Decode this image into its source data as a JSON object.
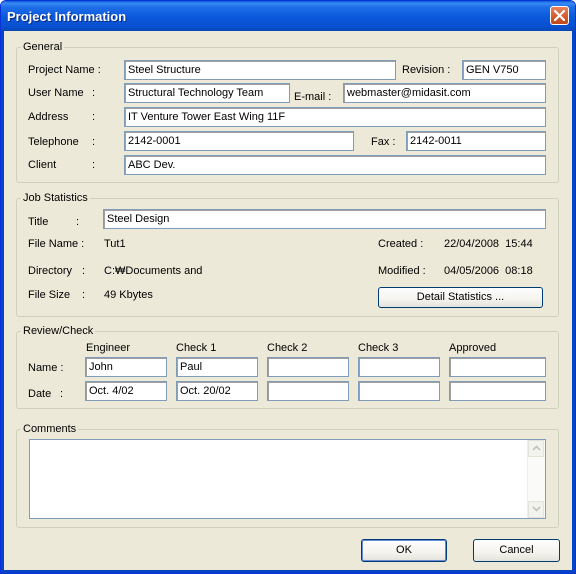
{
  "window": {
    "title": "Project Information"
  },
  "general": {
    "legend": "General",
    "project_name_label": "Project Name :",
    "project_name": "Steel Structure",
    "revision_label": "Revision :",
    "revision": "GEN V750",
    "user_name_label": "User Name",
    "user_name": "Structural Technology Team",
    "email_label": "E-mail :",
    "email": "webmaster@midasit.com",
    "address_label": "Address",
    "address": "IT Venture Tower East Wing 11F",
    "telephone_label": "Telephone",
    "telephone": "2142-0001",
    "fax_label": "Fax :",
    "fax": "2142-0011",
    "client_label": "Client",
    "client": "ABC Dev.",
    "colon": ":"
  },
  "job": {
    "legend": "Job Statistics",
    "title_label": "Title",
    "title": "Steel Design",
    "file_name_label": "File Name :",
    "file_name": "Tut1",
    "directory_label": "Directory",
    "directory": "C:₩Documents and",
    "file_size_label": "File Size",
    "file_size": "49 Kbytes",
    "created_label": "Created :",
    "created": "22/04/2008  15:44",
    "modified_label": "Modified :",
    "modified": "04/05/2006  08:18",
    "detail_button": "Detail Statistics ..."
  },
  "review": {
    "legend": "Review/Check",
    "columns": [
      "Engineer",
      "Check 1",
      "Check 2",
      "Check 3",
      "Approved"
    ],
    "name_label": "Name :",
    "date_label": "Date",
    "names": [
      "John",
      "Paul",
      "",
      "",
      ""
    ],
    "dates": [
      "Oct. 4/02",
      "Oct. 20/02",
      "",
      "",
      ""
    ]
  },
  "comments": {
    "legend": "Comments",
    "text": ""
  },
  "buttons": {
    "ok": "OK",
    "cancel": "Cancel"
  },
  "icons": {
    "close": "close-icon",
    "scroll_up": "scroll-up-arrow-icon",
    "scroll_down": "scroll-down-arrow-icon"
  }
}
